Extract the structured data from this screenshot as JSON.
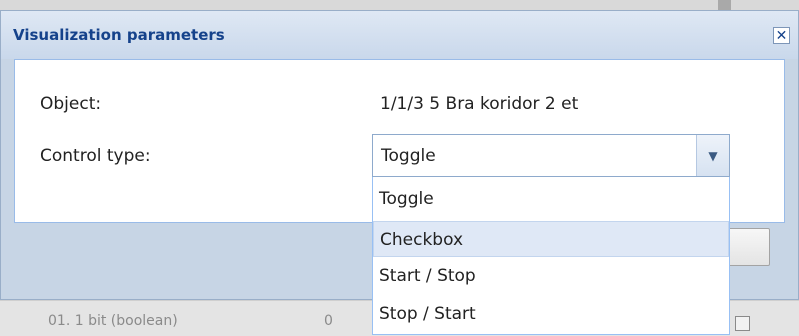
{
  "dialog": {
    "title": "Visualization parameters",
    "close_icon": "close-icon"
  },
  "form": {
    "object_label": "Object:",
    "object_value": "1/1/3 5 Bra koridor 2 et",
    "control_type_label": "Control type:",
    "control_type_value": "Toggle"
  },
  "dropdown": {
    "options": [
      "Toggle",
      "Checkbox",
      "Start / Stop",
      "Stop / Start"
    ],
    "hovered_option": "Checkbox"
  },
  "background": {
    "row_text_1": "01. 1 bit (boolean)",
    "row_text_2": "0"
  },
  "colors": {
    "title": "#15428b",
    "header": "#c9d8eb",
    "hover": "#dfe8f6"
  }
}
